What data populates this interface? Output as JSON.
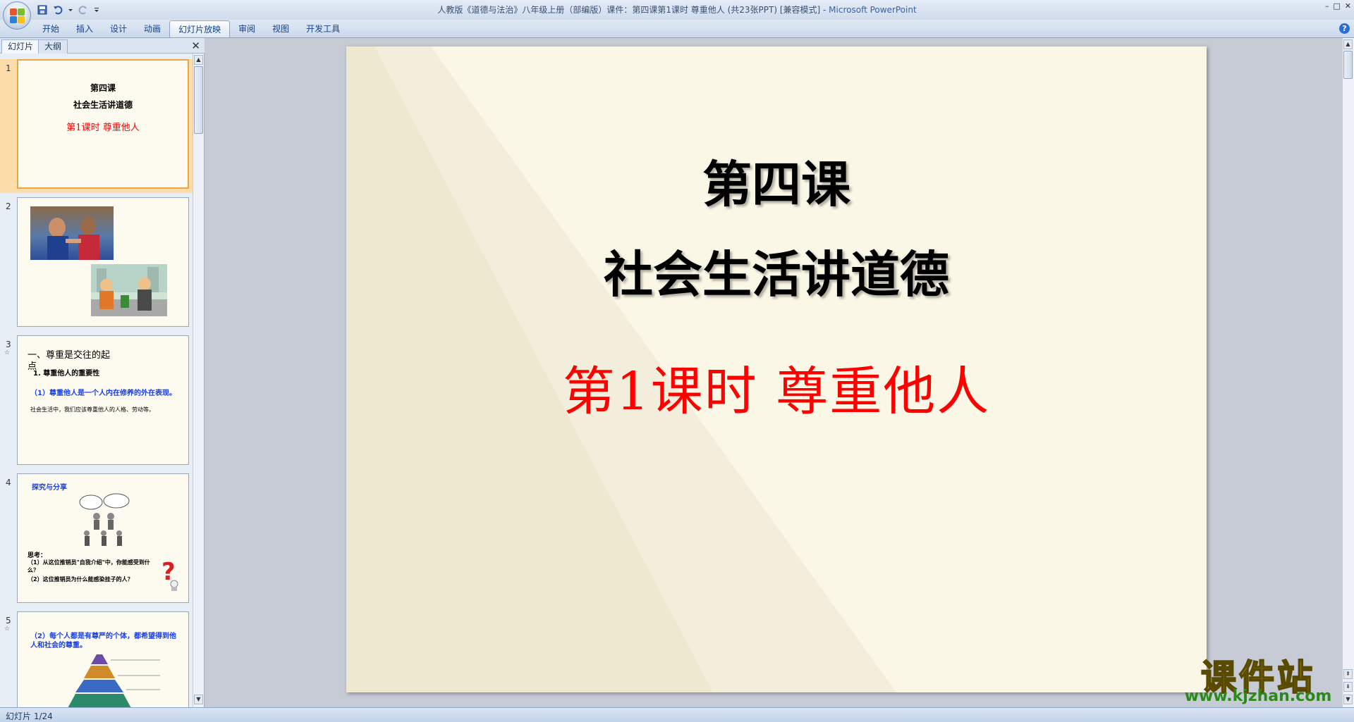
{
  "window": {
    "title": "人教版《道德与法治》八年级上册（部编版）课件：第四课第1课时 尊重他人 (共23张PPT) [兼容模式]",
    "separator": " - ",
    "app_name": "Microsoft PowerPoint",
    "controls": [
      "–",
      "□",
      "✕"
    ]
  },
  "ribbon": {
    "tabs": [
      {
        "label": "开始",
        "active": false
      },
      {
        "label": "插入",
        "active": false
      },
      {
        "label": "设计",
        "active": false
      },
      {
        "label": "动画",
        "active": false
      },
      {
        "label": "幻灯片放映",
        "active": true
      },
      {
        "label": "审阅",
        "active": false
      },
      {
        "label": "视图",
        "active": false
      },
      {
        "label": "开发工具",
        "active": false
      }
    ],
    "help": "?"
  },
  "pane": {
    "tab_slides": "幻灯片",
    "tab_outline": "大纲",
    "close": "✕"
  },
  "thumbnails": [
    {
      "num": "1",
      "line1": "第四课",
      "line2": "社会生活讲道德",
      "line3": "第1课时  尊重他人"
    },
    {
      "num": "2"
    },
    {
      "num": "3",
      "heading": "一、尊重是交往的起点",
      "sub": "1. 尊重他人的重要性",
      "blue": "（1）尊重他人是一个人内在修养的外在表现。",
      "black": "社会生活中，我们应该尊重他人的人格、劳动等。"
    },
    {
      "num": "4",
      "heading": "探究与分享",
      "q_title": "思考：",
      "q1": "（1）从这位推销员\"自我介绍\"中，你能感受到什么？",
      "q2": "（2）这位推销员为什么能感染挂子的人？"
    },
    {
      "num": "5",
      "blue": "（2）每个人都是有尊严的个体，都希望得到他人和社会的尊重。"
    }
  ],
  "slide": {
    "title1": "第四课",
    "title2": "社会生活讲道德",
    "subtitle": "第1课时  尊重他人"
  },
  "status": {
    "text": "幻灯片 1/24"
  },
  "watermark": {
    "big": "课件站",
    "url": "www.kjzhan.com"
  }
}
